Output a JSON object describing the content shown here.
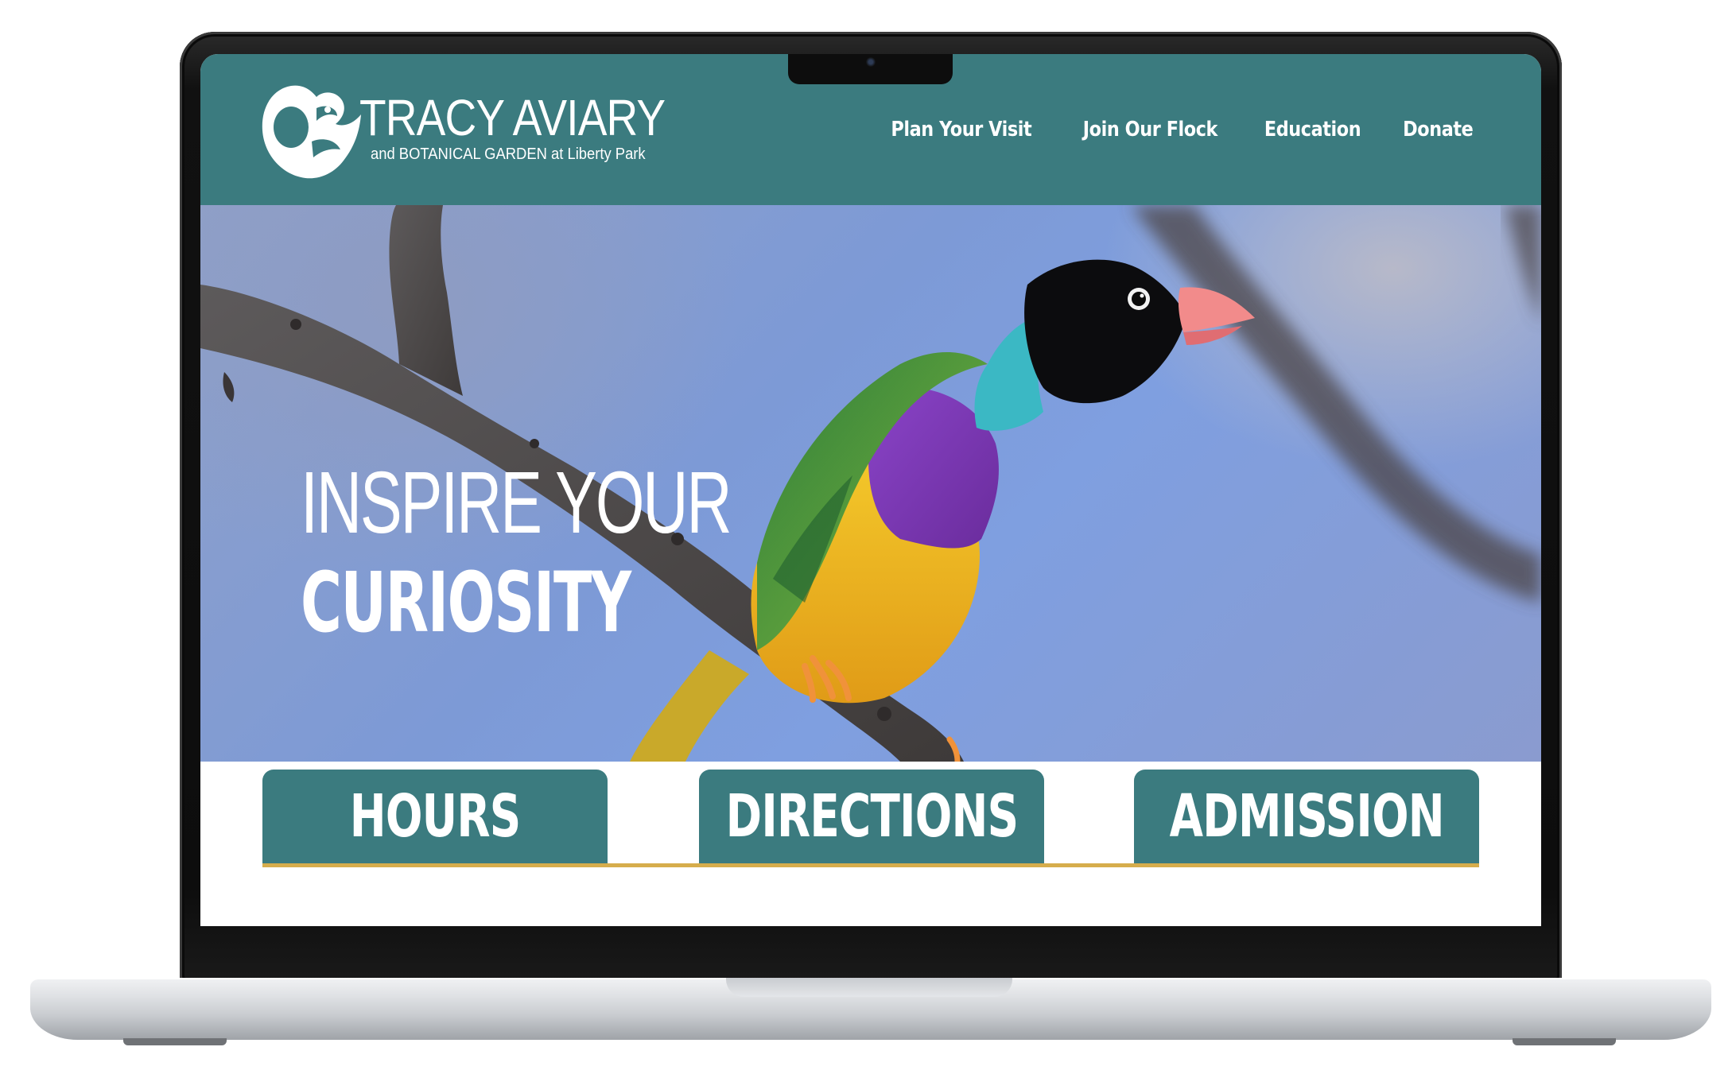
{
  "site": {
    "logo_title": "TRACY AVIARY",
    "logo_subtitle": "and BOTANICAL GARDEN at Liberty Park"
  },
  "nav": {
    "items": [
      {
        "label": "Plan Your Visit"
      },
      {
        "label": "Join Our Flock"
      },
      {
        "label": "Education"
      },
      {
        "label": "Donate"
      }
    ]
  },
  "hero": {
    "line1": "INSPIRE YOUR",
    "line2": "CURIOSITY"
  },
  "quick_links": [
    {
      "label": "HOURS"
    },
    {
      "label": "DIRECTIONS"
    },
    {
      "label": "ADMISSION"
    }
  ],
  "colors": {
    "brand_teal": "#3b7b7f",
    "accent_gold": "#d6ad4c",
    "text_white": "#ffffff"
  },
  "icons": {
    "logo": "bird-logo-icon",
    "hero_image": "gouldian-finch-photo"
  }
}
